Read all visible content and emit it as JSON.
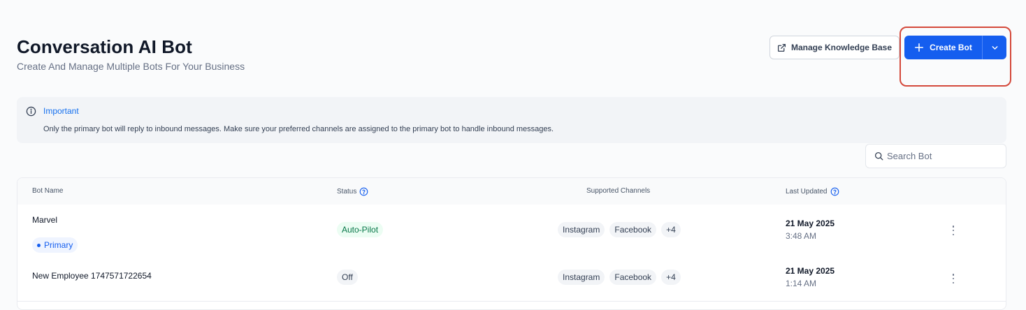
{
  "header": {
    "title": "Conversation AI Bot",
    "subtitle": "Create And Manage Multiple Bots For Your Business",
    "manage_kb_label": "Manage Knowledge Base",
    "create_bot_label": "Create Bot"
  },
  "alert": {
    "title": "Important",
    "message": "Only the primary bot will reply to inbound messages. Make sure your preferred channels are assigned to the primary bot to handle inbound messages."
  },
  "search": {
    "placeholder": "Search Bot",
    "value": ""
  },
  "table": {
    "columns": {
      "bot_name": "Bot Name",
      "status": "Status",
      "channels": "Supported Channels",
      "last_updated": "Last Updated"
    },
    "rows": [
      {
        "name": "Marvel",
        "badge": "Primary",
        "status": "Auto-Pilot",
        "channels": [
          "Instagram",
          "Facebook"
        ],
        "more_channels": "+4",
        "date": "21 May 2025",
        "time": "3:48 AM"
      },
      {
        "name": "New Employee 1747571722654",
        "status": "Off",
        "channels": [
          "Instagram",
          "Facebook"
        ],
        "more_channels": "+4",
        "date": "21 May 2025",
        "time": "1:14 AM"
      }
    ]
  },
  "colors": {
    "primary": "#155eef",
    "highlight": "#d4493b",
    "status_on_bg": "#ecfdf3",
    "status_on_text": "#067647"
  },
  "icons": {
    "external": "external-link-icon",
    "plus": "plus-icon",
    "caret": "chevron-down-icon",
    "info": "info-icon",
    "search": "search-icon",
    "help": "question-circle-icon",
    "more": "kebab-menu-icon"
  }
}
